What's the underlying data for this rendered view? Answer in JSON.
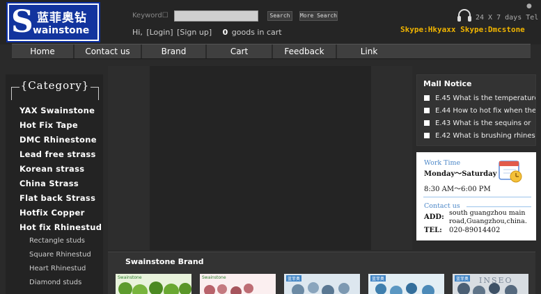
{
  "logo": {
    "cn_text": "蓝菲奥钻",
    "letter": "S",
    "en_text": "wainstone",
    "colors": {
      "bg": "#12349e",
      "frame": "#ffffff"
    }
  },
  "header": {
    "keyword_label": "Keyword☐",
    "keyword_value": "",
    "search_label": "Search",
    "more_search_label": "More Search",
    "greeting": "Hi,",
    "login_label": "[Login]",
    "signup_label": "[Sign up]",
    "cart_count": "0",
    "cart_text": "goods in cart",
    "dot": "●",
    "tel_text": "24 X 7 days Tel",
    "skype_text": "Skype:Hkyaxx  Skype:Dmcstone",
    "icons": {
      "headset": "headset-icon"
    }
  },
  "nav": {
    "items": [
      {
        "label": "Home"
      },
      {
        "label": "Contact us"
      },
      {
        "label": "Brand"
      },
      {
        "label": "Cart"
      },
      {
        "label": "Feedback"
      },
      {
        "label": "Link"
      }
    ]
  },
  "sidebar": {
    "title": "Category",
    "categories": [
      "YAX Swainstone",
      "Hot Fix Tape",
      "DMC Rhinestone",
      "Lead free strass",
      "Korean strass",
      "China Strass",
      "Flat back Strass",
      "Hotfix Copper",
      "Hot fix Rhinestud"
    ],
    "subcategories": [
      "Rectangle studs",
      "Square Rhinestud",
      "Heart Rhinestud",
      "Diamond studs"
    ]
  },
  "notice": {
    "title": "Mall Notice",
    "items": [
      "E.45 What is the temperature",
      "E.44 How to hot fix when the",
      "E.43 What is the sequins or",
      "E.42 What is brushing rhinestone"
    ]
  },
  "contact": {
    "work_time_label": "Work Time",
    "days": "Monday～Saturday",
    "hours": "8:30 AM～6:00 PM",
    "contact_label": "Contact us",
    "add_label": "ADD:",
    "address_line1": "south guangzhou main",
    "address_line2": "road,Guangzhou,china.",
    "tel_label": "TEL:",
    "tel_value": "020-89014402",
    "colors": {
      "accent": "#4d88c8"
    },
    "icons": {
      "calendar": "calendar-clock-icon"
    }
  },
  "brand": {
    "title": "Swainstone Brand",
    "thumbs": [
      {
        "label": "Swainstone"
      },
      {
        "label": "Swainstone"
      },
      {
        "label": "蓝菲奥"
      },
      {
        "label": "蓝菲奥"
      },
      {
        "label": "蓝菲奥"
      }
    ],
    "watermark": "INSEO"
  }
}
